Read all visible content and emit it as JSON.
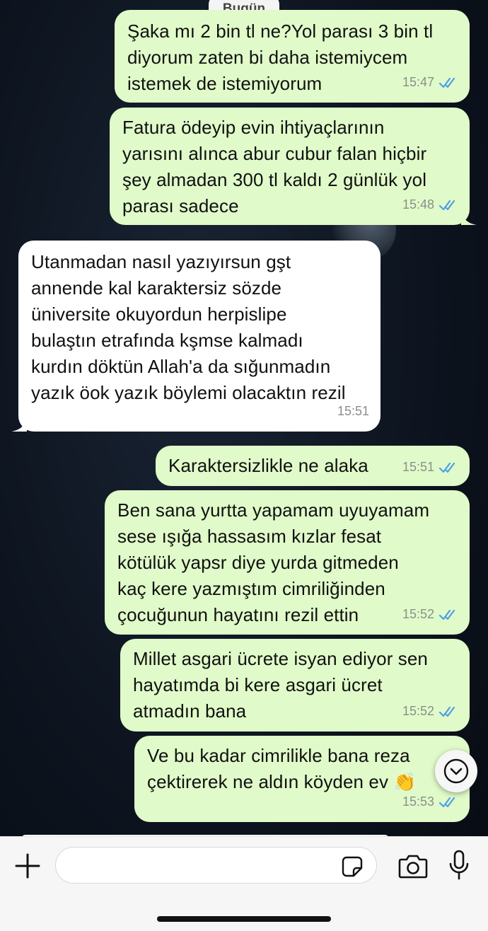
{
  "chat": {
    "date_separator": "Bugün",
    "messages": [
      {
        "text": "Şaka mı 2 bin tl ne?Yol parası 3 bin tl\ndiyorum zaten bi daha istemiycem\nistemek de istemiyorum",
        "time": "15:47"
      },
      {
        "text": "Fatura ödeyip evin ihtiyaçlarının\nyarısını alınca abur cubur falan hiçbir\nşey almadan 300 tl kaldı 2 günlük yol\nparası sadece",
        "time": "15:48"
      },
      {
        "text": "Utanmadan nasıl yazıyırsun gşt\nannende kal karaktersiz sözde\nüniversite okuyordun herpislipe\nbulaştın etrafında kşmse kalmadı\nkurdın döktün Allah'a da sığunmadın\nyazık öok yazık böylemi olacaktın rezil",
        "time": "15:51"
      },
      {
        "text": "Karaktersizlikle ne alaka",
        "time": "15:51"
      },
      {
        "text": "Ben sana yurtta yapamam uyuyamam\nsese ışığa hassasım kızlar fesat\nkötülük yapsr diye yurda gitmeden\nkaç kere yazmıştım cimriliğinden\nçocuğunun hayatını rezil ettin",
        "time": "15:52"
      },
      {
        "text": "Millet asgari ücrete isyan ediyor sen\nhayatımda bi kere asgari ücret\natmadın bana",
        "time": "15:52"
      },
      {
        "text": "Ve bu kadar cimrilikle bana reza\nçektirerek ne aldın köyden ev 👏",
        "time": "15:53"
      }
    ]
  },
  "composer": {
    "placeholder": "",
    "icons": [
      "plus-icon",
      "sticker-icon",
      "camera-icon",
      "microphone-icon"
    ]
  },
  "scroll_button": {
    "icon": "chevron-down-icon"
  },
  "colors": {
    "outgoing_bubble": "#e0fbc9",
    "incoming_bubble": "#ffffff",
    "read_ticks": "#4f9ee8",
    "wallpaper": "#0d141f"
  }
}
